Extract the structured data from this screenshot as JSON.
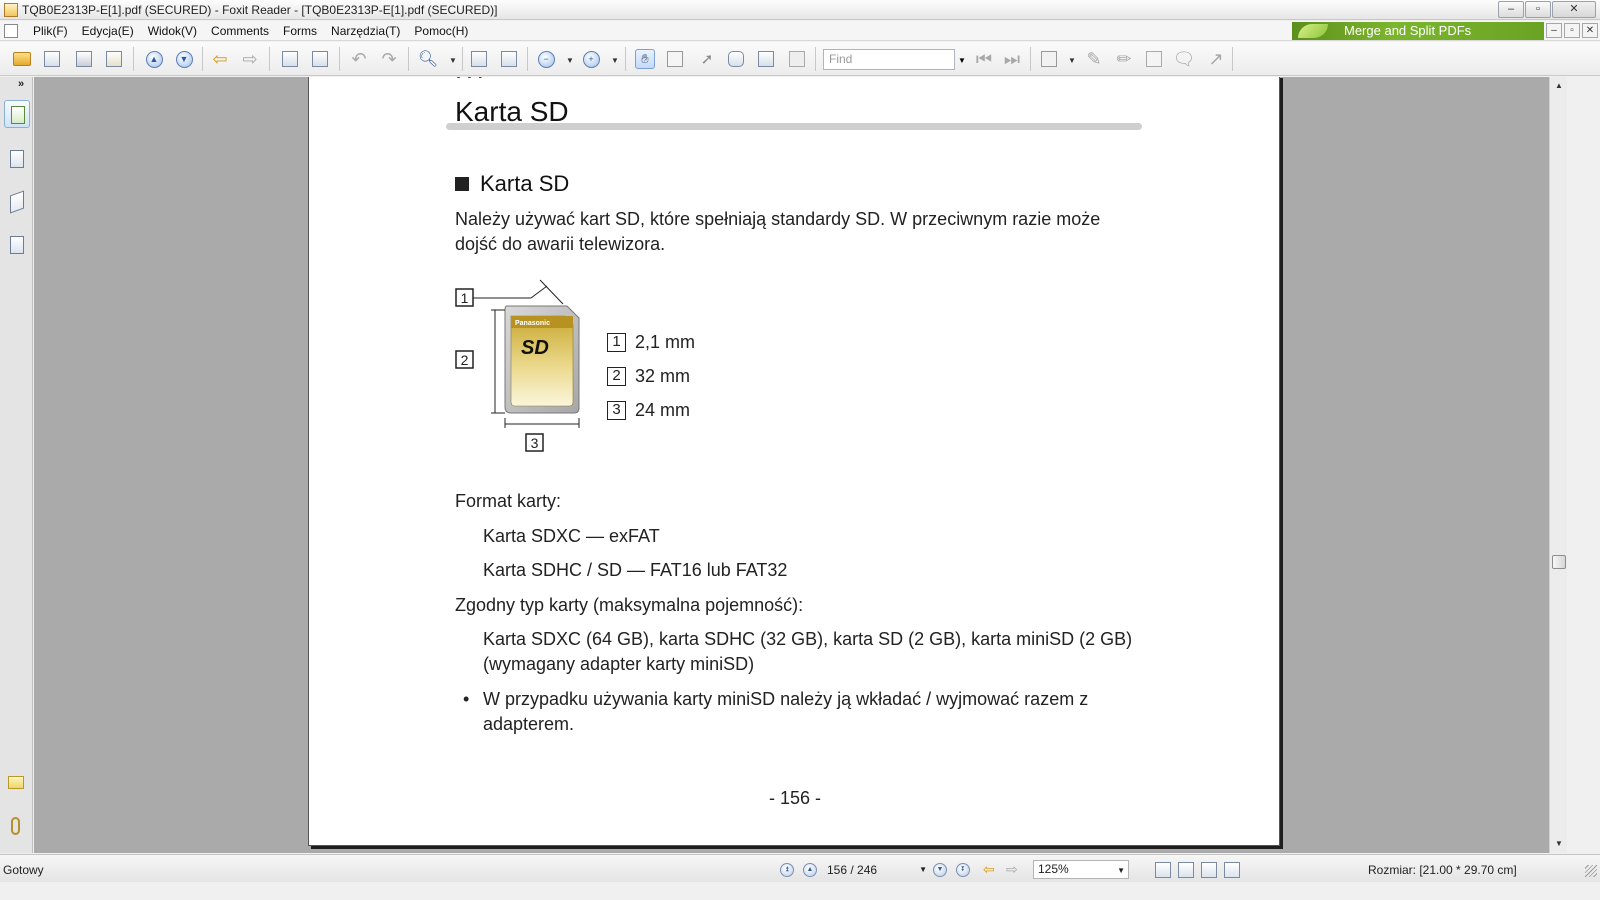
{
  "window": {
    "title": "TQB0E2313P-E[1].pdf (SECURED) - Foxit Reader - [TQB0E2313P-E[1].pdf (SECURED)]",
    "minimize": "–",
    "maximize": "▫",
    "close": "✕"
  },
  "menu": {
    "items": [
      "Plik(F)",
      "Edycja(E)",
      "Widok(V)",
      "Comments",
      "Forms",
      "Narzędzia(T)",
      "Pomoc(H)"
    ],
    "banner": "Merge and Split PDFs",
    "doc_minimize": "–",
    "doc_restore": "▫",
    "doc_close": "✕"
  },
  "toolbar": {
    "find_placeholder": "Find"
  },
  "page": {
    "title": "Karta SD",
    "section_heading": "Karta SD",
    "intro": "Należy używać kart SD, które spełniają standardy SD. W przeciwnym razie może dojść do awarii telewizora.",
    "card_brand": "Panasonic",
    "card_logo": "SD",
    "dimensions": [
      {
        "num": "1",
        "value": "2,1 mm"
      },
      {
        "num": "2",
        "value": "32 mm"
      },
      {
        "num": "3",
        "value": "24 mm"
      }
    ],
    "format_label": "Format karty:",
    "format_sdxc": "Karta SDXC — exFAT",
    "format_sdhc": "Karta SDHC / SD — FAT16 lub FAT32",
    "compat_label": "Zgodny typ karty (maksymalna pojemność):",
    "compat_cards": "Karta SDXC (64 GB), karta SDHC (32 GB), karta SD (2 GB), karta miniSD (2 GB) (wymagany adapter karty miniSD)",
    "bullet": "W przypadku używania karty miniSD należy ją wkładać / wyjmować razem z adapterem.",
    "page_number": "- 156 -"
  },
  "status": {
    "ready": "Gotowy",
    "page_indicator": "156 / 246",
    "zoom": "125%",
    "size": "Rozmiar: [21.00 * 29.70 cm]"
  }
}
